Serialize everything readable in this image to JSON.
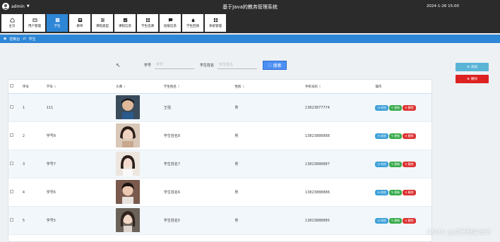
{
  "header": {
    "user": "admin",
    "title": "基于Java的教务管理系统",
    "datetime": "2024-1-26 15:00"
  },
  "nav": [
    {
      "label": "主页",
      "icon": "home-icon"
    },
    {
      "label": "用户管理",
      "icon": "user-card-icon"
    },
    {
      "label": "学生",
      "icon": "student-icon",
      "active": true
    },
    {
      "label": "教师",
      "icon": "teacher-icon"
    },
    {
      "label": "课程类型",
      "icon": "filter-icon"
    },
    {
      "label": "课程信息",
      "icon": "book-icon"
    },
    {
      "label": "学生选课",
      "icon": "grid-icon"
    },
    {
      "label": "班级信息",
      "icon": "chat-icon"
    },
    {
      "label": "学生回请",
      "icon": "hand-icon"
    },
    {
      "label": "系统管理",
      "icon": "grid-icon"
    }
  ],
  "breadcrumb": {
    "home": "控制台",
    "current": "学生"
  },
  "search": {
    "field1_label": "学号",
    "field1_placeholder": "学号",
    "field2_label": "学生姓名",
    "field2_placeholder": "学生姓名",
    "button": "搜索"
  },
  "actions": {
    "add": "添加",
    "delete": "删除"
  },
  "table": {
    "headers": {
      "index": "序号",
      "xuehao": "学号",
      "avatar": "头像",
      "name": "学生姓名",
      "sex": "性别",
      "phone": "手机号码",
      "ops": "操作"
    },
    "op_labels": {
      "view": "浏览",
      "edit": "更新",
      "delete": "删除"
    },
    "rows": [
      {
        "index": "1",
        "xuehao": "111",
        "name": "王强",
        "sex": "男",
        "phone": "13823877774"
      },
      {
        "index": "2",
        "xuehao": "学号8",
        "name": "学生姓名8",
        "sex": "男",
        "phone": "13823888888"
      },
      {
        "index": "3",
        "xuehao": "学号7",
        "name": "学生姓名7",
        "sex": "男",
        "phone": "13823888887"
      },
      {
        "index": "4",
        "xuehao": "学号6",
        "name": "学生姓名6",
        "sex": "男",
        "phone": "13823888886"
      },
      {
        "index": "5",
        "xuehao": "学号5",
        "name": "学生姓名5",
        "sex": "男",
        "phone": "13823888885"
      }
    ]
  },
  "watermark": "CSDN @成承程序设计"
}
